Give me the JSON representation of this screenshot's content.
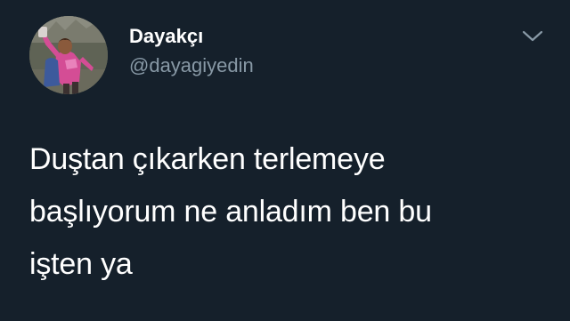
{
  "tweet": {
    "author": {
      "display_name": "Dayakçı",
      "handle": "@dayagiyedin",
      "avatar_icon": "profile-photo"
    },
    "menu_icon": "chevron-down-icon",
    "text_lines": [
      "Duştan çıkarken terlemeye",
      "başlıyorum ne anladım ben bu",
      "işten ya"
    ]
  },
  "colors": {
    "background": "#15202b",
    "primary_text": "#ffffff",
    "secondary_text": "#8899a6"
  }
}
